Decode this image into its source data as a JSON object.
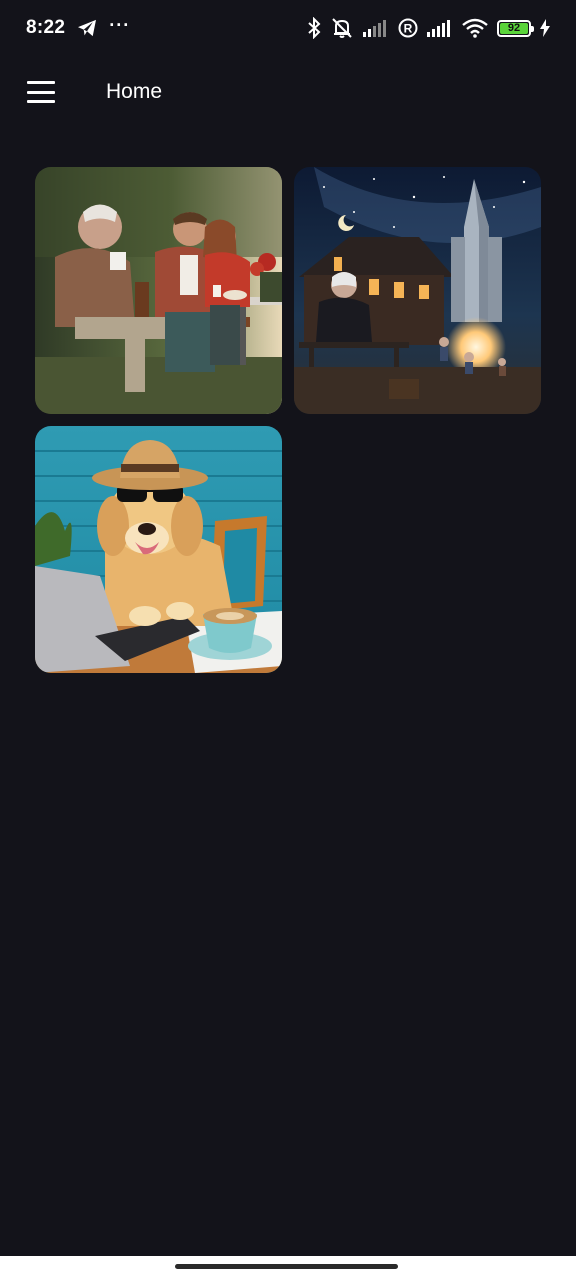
{
  "status_bar": {
    "time": "8:22",
    "more": "···",
    "battery_level": "92",
    "icons": [
      "telegram-icon",
      "bluetooth-icon",
      "mute-vibrate-icon",
      "signal-icon",
      "registered-icon",
      "signal-icon",
      "wifi-icon",
      "battery-icon",
      "charging-icon"
    ]
  },
  "app_bar": {
    "title": "Home",
    "menu_icon": "hamburger-menu-icon"
  },
  "gallery": {
    "images": [
      {
        "subject": "elderly-man-drinking-coffee-with-couple-on-park-bench"
      },
      {
        "subject": "old-man-at-desk-with-rocket-launch-at-night"
      },
      {
        "subject": "golden-retriever-with-hat-and-sunglasses-at-laptop-with-coffee"
      }
    ]
  },
  "colors": {
    "background": "#13131a",
    "battery": "#5ad33a"
  }
}
